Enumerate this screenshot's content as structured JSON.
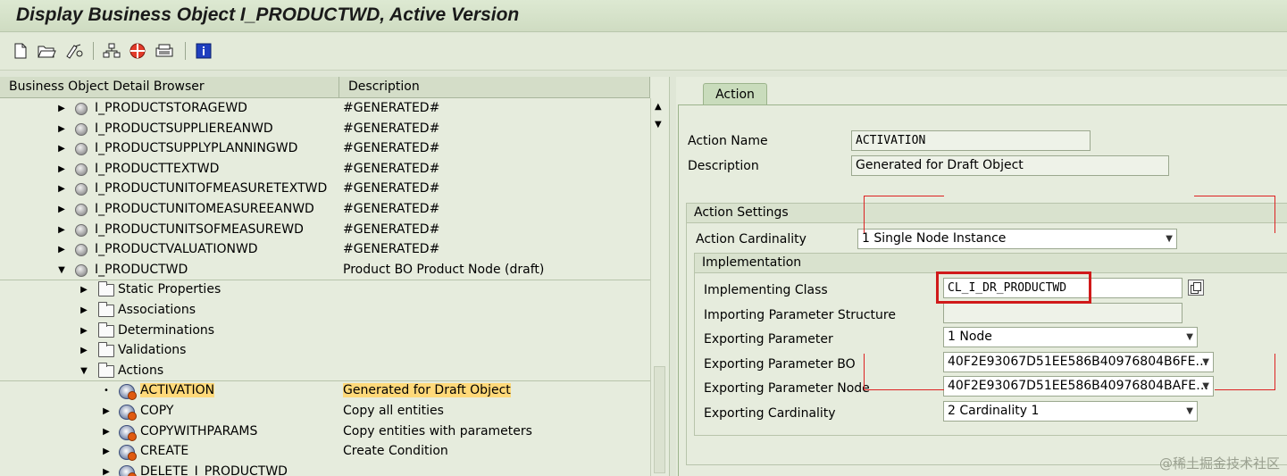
{
  "window": {
    "title": "Display Business Object I_PRODUCTWD, Active Version"
  },
  "toolbar": {
    "icons": [
      "new-document-icon",
      "open-folder-icon",
      "edit-glasses-icon",
      "hierarchy-icon",
      "check-icon",
      "print-icon",
      "info-icon"
    ]
  },
  "browser": {
    "col_name": "Business Object Detail Browser",
    "col_desc": "Description",
    "nodes": [
      {
        "name": "I_PRODUCTSTORAGEWD",
        "desc": "#GENERATED#"
      },
      {
        "name": "I_PRODUCTSUPPLIEREANWD",
        "desc": "#GENERATED#"
      },
      {
        "name": "I_PRODUCTSUPPLYPLANNINGWD",
        "desc": "#GENERATED#"
      },
      {
        "name": "I_PRODUCTTEXTWD",
        "desc": "#GENERATED#"
      },
      {
        "name": "I_PRODUCTUNITOFMEASURETEXTWD",
        "desc": "#GENERATED#"
      },
      {
        "name": "I_PRODUCTUNITOMEASUREEANWD",
        "desc": "#GENERATED#"
      },
      {
        "name": "I_PRODUCTUNITSOFMEASUREWD",
        "desc": "#GENERATED#"
      },
      {
        "name": "I_PRODUCTVALUATIONWD",
        "desc": "#GENERATED#"
      },
      {
        "name": "I_PRODUCTWD",
        "desc": "Product BO Product Node (draft)"
      }
    ],
    "folders": [
      "Static Properties",
      "Associations",
      "Determinations",
      "Validations",
      "Actions"
    ],
    "actions": [
      {
        "name": "ACTIVATION",
        "desc": "Generated for Draft Object"
      },
      {
        "name": "COPY",
        "desc": "Copy all entities"
      },
      {
        "name": "COPYWITHPARAMS",
        "desc": "Copy entities with parameters"
      },
      {
        "name": "CREATE",
        "desc": "Create Condition"
      },
      {
        "name": "DELETE_I_PRODUCTWD",
        "desc": ""
      }
    ]
  },
  "detail": {
    "tab": "Action",
    "action_name_label": "Action Name",
    "action_name_value": "ACTIVATION",
    "description_label": "Description",
    "description_value": "Generated for Draft Object",
    "settings_head": "Action Settings",
    "cardinality_label": "Action Cardinality",
    "cardinality_value": "1 Single Node Instance",
    "impl_head": "Implementation",
    "impl_class_label": "Implementing Class",
    "impl_class_value": "CL_I_DR_PRODUCTWD",
    "import_struct_label": "Importing Parameter Structure",
    "import_struct_value": "",
    "export_param_label": "Exporting Parameter",
    "export_param_value": "1 Node",
    "export_bo_label": "Exporting Parameter BO",
    "export_bo_value": "40F2E93067D51EE586B40976804B6FE…",
    "export_node_label": "Exporting Parameter Node",
    "export_node_value": "40F2E93067D51EE586B40976804BAFE…",
    "export_card_label": "Exporting Cardinality",
    "export_card_value": "2 Cardinality 1"
  },
  "watermark": "@稀土掘金技术社区",
  "colors": {
    "highlight": "#ffd97a",
    "annotation_red": "#d01a1a",
    "background": "#e6ecdd"
  }
}
